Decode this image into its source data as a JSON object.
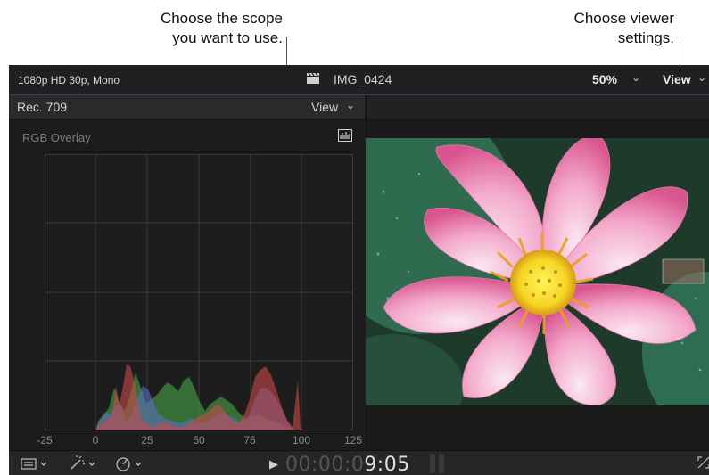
{
  "callouts": {
    "scope": {
      "line1": "Choose the scope",
      "line2": "you want to use."
    },
    "settings": {
      "line1": "Choose viewer",
      "line2": "settings."
    }
  },
  "topbar": {
    "format": "1080p HD 30p, Mono",
    "clip_icon": "clapper-icon",
    "clip_name": "IMG_0424",
    "zoom": "50%",
    "view_label": "View"
  },
  "scope": {
    "standard": "Rec. 709",
    "view_label": "View",
    "type_label": "RGB Overlay",
    "type_icon": "histogram-icon",
    "axis_ticks": [
      "-25",
      "0",
      "25",
      "50",
      "75",
      "100",
      "125"
    ],
    "colors": {
      "red": "#c84a4a",
      "green": "#3f8a3f",
      "blue": "#5a6fc0"
    }
  },
  "timeline": {
    "timecode_dim": "00:00:0",
    "timecode_bright": "9:05",
    "tools": [
      "clip-appearance-icon",
      "transform-icon",
      "speed-icon"
    ]
  }
}
